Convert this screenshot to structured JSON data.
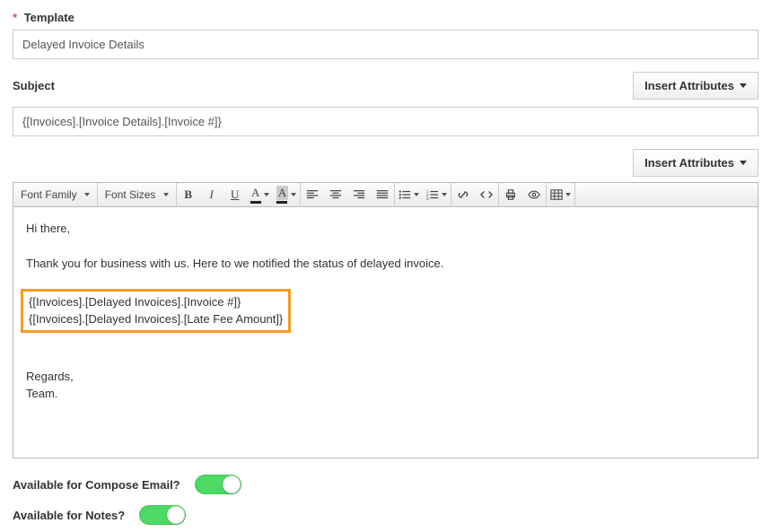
{
  "labels": {
    "template": "Template",
    "subject": "Subject",
    "insert_attributes": "Insert Attributes",
    "avail_compose": "Available for Compose Email?",
    "avail_notes": "Available for Notes?"
  },
  "fields": {
    "template_value": "Delayed Invoice Details",
    "subject_value": "{[Invoices].[Invoice Details].[Invoice #]}"
  },
  "toolbar": {
    "font_family": "Font Family",
    "font_sizes": "Font Sizes"
  },
  "editor": {
    "greeting": "Hi there,",
    "body1": "Thank you for business with us. Here to we notified the status of delayed invoice.",
    "merge1": "{[Invoices].[Delayed Invoices].[Invoice #]}",
    "merge2": "{[Invoices].[Delayed Invoices].[Late Fee Amount]}",
    "signoff1": "Regards,",
    "signoff2": "Team."
  }
}
